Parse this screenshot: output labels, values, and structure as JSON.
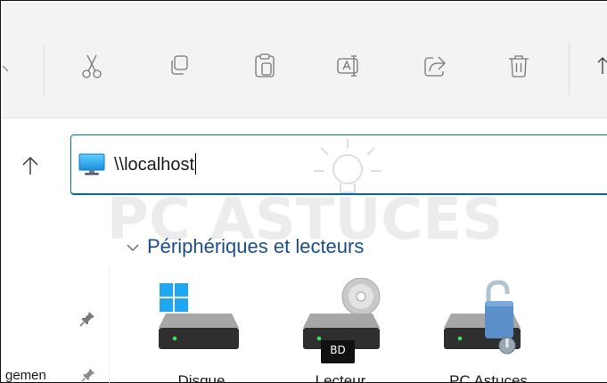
{
  "toolbar": {
    "icons": [
      "scissors-icon",
      "copy-icon",
      "paste-icon",
      "rename-icon",
      "share-icon",
      "delete-icon",
      "sort-icon"
    ]
  },
  "address_bar": {
    "icon": "computer-icon",
    "value": "\\\\localhost"
  },
  "watermark": {
    "text": "PC ASTUCES"
  },
  "section": {
    "title": "Périphériques et lecteurs"
  },
  "left_pane": {
    "truncated_label": "gemen"
  },
  "drives": [
    {
      "icon": "windows-drive-icon",
      "label": "Disque"
    },
    {
      "icon": "bd-drive-icon",
      "label": "Lecteur",
      "badge": "BD"
    },
    {
      "icon": "network-drive-icon",
      "label": "PC Astuces"
    }
  ],
  "colors": {
    "accent": "#0067c0",
    "section_title": "#1b4f8a",
    "toolbar_bg": "#f3f3f3"
  }
}
